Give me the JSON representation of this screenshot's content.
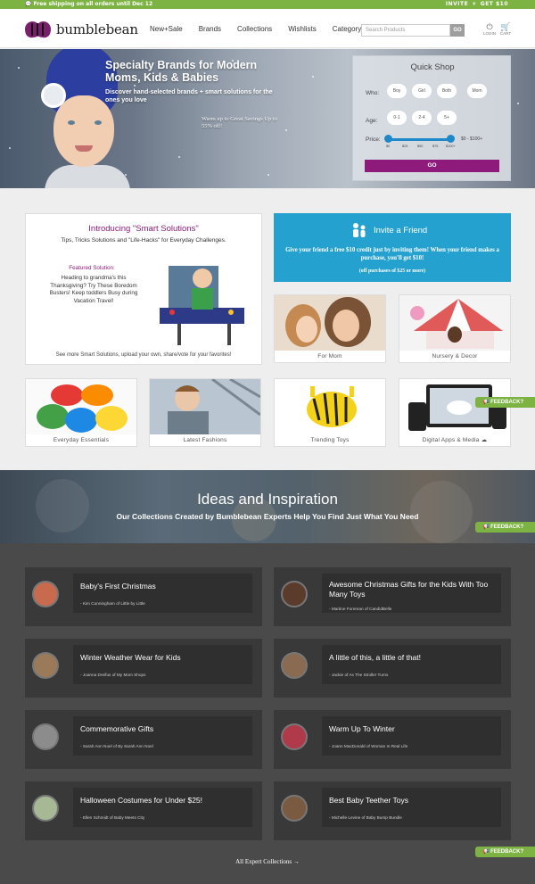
{
  "promo": {
    "left_text": "💬 Free shipping on all orders until Dec 12",
    "invite": "INVITE",
    "plus": "+",
    "get": "GET $10"
  },
  "header": {
    "logo_text": "bumblebean",
    "nav": [
      "New+Sale",
      "Brands",
      "Collections",
      "Wishlists",
      "Category"
    ],
    "search_placeholder": "Search Products",
    "search_button": "GO",
    "login_label": "LOGIN",
    "cart_label": "CART"
  },
  "hero": {
    "title": "Specialty Brands for Modern Moms, Kids & Babies",
    "subtitle": "Discover hand-selected brands + smart solutions for the ones you love",
    "promo": "Warm up to Great Savings Up to 55% off!"
  },
  "quick_shop": {
    "title": "Quick Shop",
    "who_label": "Who:",
    "who_options": [
      "Boy",
      "Girl",
      "Both",
      "Mom"
    ],
    "age_label": "Age:",
    "age_options": [
      "0-1",
      "2-4",
      "5+"
    ],
    "price_label": "Price:",
    "price_ticks": [
      "$0",
      "$25",
      "$50",
      "$75",
      "$100+"
    ],
    "price_range": "$0 - $100+",
    "go": "GO"
  },
  "smart_solutions": {
    "title": "Introducing \"Smart Solutions\"",
    "subtitle": "Tips, Tricks Solutions and \"Life-Hacks\" for Everyday Challenges.",
    "featured_label": "Featured Solution:",
    "featured_text": "Heading to grandma's this Thanksgiving? Try These Boredom Busters! Keep toddlers Busy during Vacation Travel!",
    "footer": "See more Smart Solutions, upload your own, share/vote for your favorites!"
  },
  "invite_box": {
    "title": "Invite a Friend",
    "body": "Give your friend a free $10 credit just by inviting them! When your friend makes a purchase, you'll get $10!",
    "small": "(off purchases of $25 or more)"
  },
  "tiles": [
    "For Mom",
    "Nursery & Decor",
    "Everyday Essentials",
    "Latest Fashions",
    "Trending Toys",
    "Digital Apps & Media"
  ],
  "feedback_label": "FEEDBACK?",
  "ideas": {
    "title": "Ideas and Inspiration",
    "subtitle": "Our Collections Created by Bumblebean Experts Help You Find Just What You Need",
    "cards": [
      {
        "title": "Baby's First Christmas",
        "byline": "- Kim Cunningham of Little by Little"
      },
      {
        "title": "Awesome Christmas Gifts for the Kids With Too Many Toys",
        "byline": "- Martine Foreman of CandidBelle"
      },
      {
        "title": "Winter Weather Wear for Kids",
        "byline": "- Joanna Dreifus of My Mom Shops"
      },
      {
        "title": "A little of this, a little of that!",
        "byline": "- Jackie of As The Stroller Turns"
      },
      {
        "title": "Commemorative Gifts",
        "byline": "- Sarah Ann Noel of By Sarah Ann Noel"
      },
      {
        "title": "Warm Up To Winter",
        "byline": "- Joann MacDonald of Woman In Real Life"
      },
      {
        "title": "Halloween Costumes for Under $25!",
        "byline": "- Ellen Schmidt of Baby Meets City"
      },
      {
        "title": "Best Baby Teether Toys",
        "byline": "- Michelle Levine of Baby Bump Bundle"
      }
    ],
    "all_link": "All Expert Collections →"
  },
  "colors": {
    "brand_purple": "#8e1a7c",
    "accent_green": "#7cb342",
    "invite_blue": "#24a1cf"
  }
}
